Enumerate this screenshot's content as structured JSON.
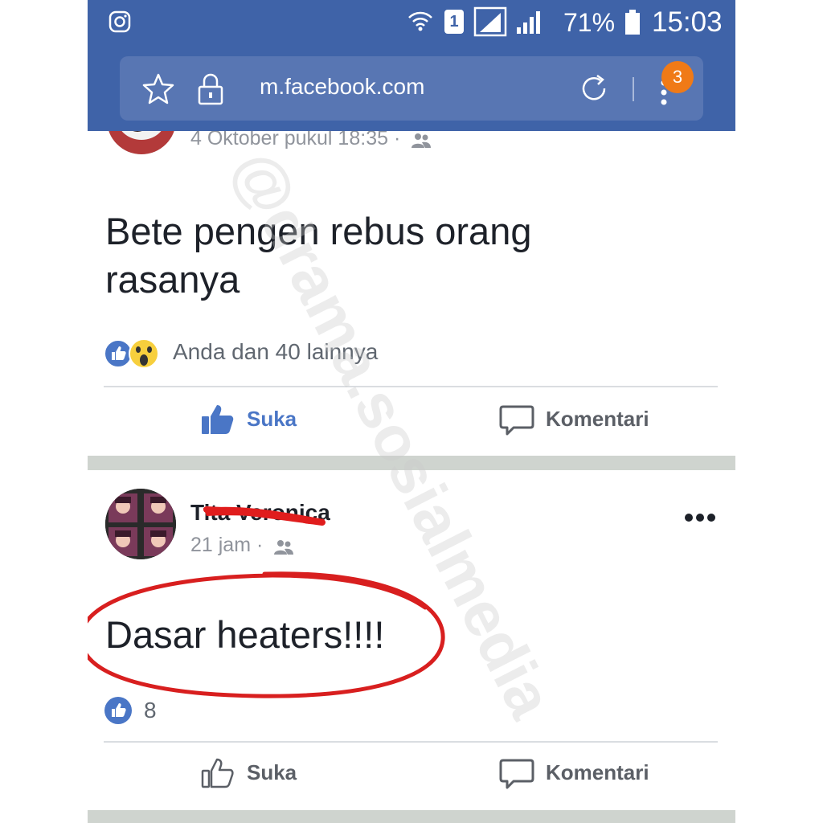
{
  "status_bar": {
    "battery_percent": "71%",
    "time": "15:03",
    "sim_label": "1",
    "icons": [
      "instagram-icon",
      "wifi-icon",
      "sim-icon",
      "signal-icon",
      "battery-icon"
    ]
  },
  "browser": {
    "url": "m.facebook.com",
    "menu_badge": "3",
    "icons": [
      "star-icon",
      "lock-icon",
      "reload-icon",
      "menu-icon"
    ]
  },
  "post1": {
    "timestamp": "4 Oktober pukul 18:35 ·",
    "text": "Bete pengen rebus orang rasanya",
    "reactions_text": "Anda dan 40 lainnya",
    "like_label": "Suka",
    "comment_label": "Komentari",
    "liked": true
  },
  "post2": {
    "author": "Tita Veronica",
    "timestamp": "21 jam ·",
    "text": "Dasar heaters!!!!",
    "reaction_count": "8",
    "like_label": "Suka",
    "comment_label": "Komentari",
    "liked": false
  },
  "watermark": "@drama.sosialmedia",
  "colors": {
    "browser_bar": "#3f63a8",
    "facebook_blue": "#4a76c6",
    "badge_orange": "#f07a17",
    "annotation_red": "#d81f1f"
  }
}
